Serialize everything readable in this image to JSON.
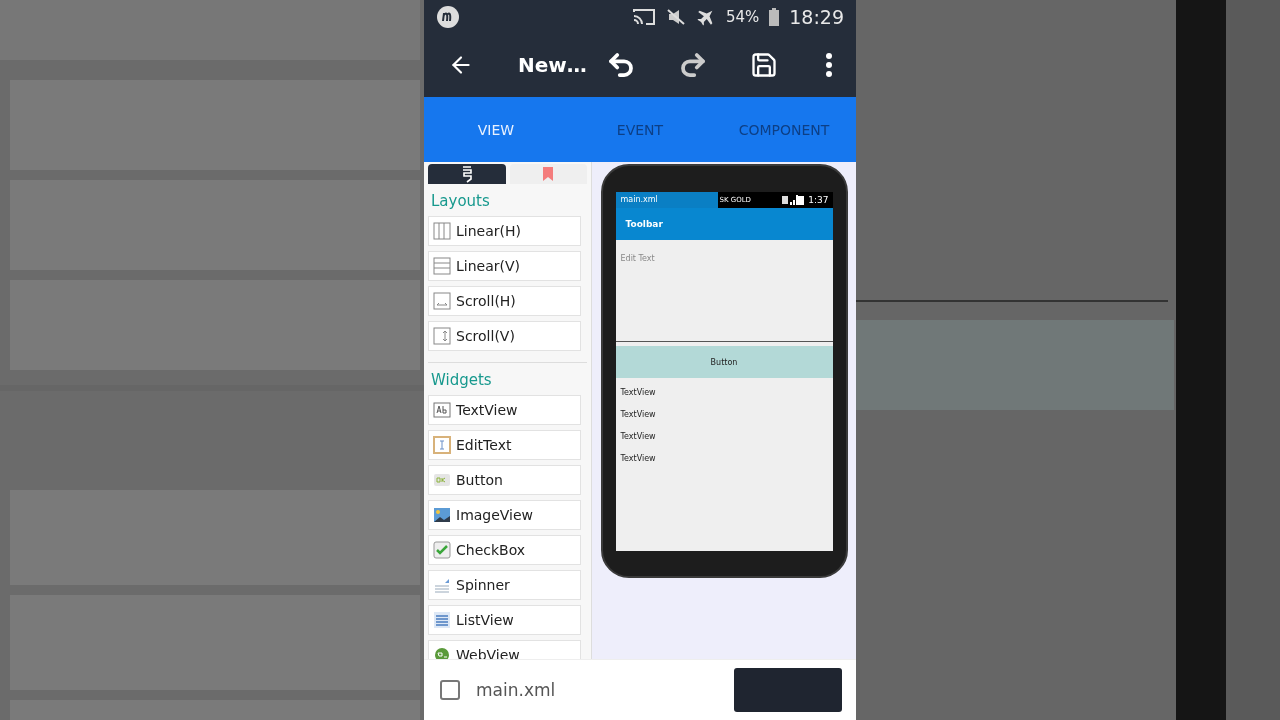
{
  "status_bar": {
    "battery": "54%",
    "time": "18:29"
  },
  "toolbar": {
    "title": "New…"
  },
  "tabs": [
    {
      "label": "VIEW",
      "selected": true
    },
    {
      "label": "EVENT",
      "selected": false
    },
    {
      "label": "COMPONENT",
      "selected": false
    }
  ],
  "palette": {
    "tabs": [
      {
        "kind": "widgets",
        "selected": true
      },
      {
        "kind": "bookmark",
        "selected": false
      }
    ],
    "sections": [
      {
        "title": "Layouts",
        "items": [
          {
            "label": "Linear(H)",
            "kind": "linear-h"
          },
          {
            "label": "Linear(V)",
            "kind": "linear-v"
          },
          {
            "label": "Scroll(H)",
            "kind": "scroll-h"
          },
          {
            "label": "Scroll(V)",
            "kind": "scroll-v"
          }
        ]
      },
      {
        "title": "Widgets",
        "items": [
          {
            "label": "TextView",
            "kind": "textview"
          },
          {
            "label": "EditText",
            "kind": "edittext"
          },
          {
            "label": "Button",
            "kind": "button"
          },
          {
            "label": "ImageView",
            "kind": "imageview"
          },
          {
            "label": "CheckBox",
            "kind": "checkbox"
          },
          {
            "label": "Spinner",
            "kind": "spinner"
          },
          {
            "label": "ListView",
            "kind": "listview"
          },
          {
            "label": "WebView",
            "kind": "webview"
          }
        ]
      }
    ]
  },
  "preview": {
    "file": "main.xml",
    "carrier": "SK GOLD",
    "time": "1:37",
    "toolbar_title": "Toolbar",
    "widgets": [
      {
        "kind": "edittext",
        "hint": "Edit Text"
      },
      {
        "kind": "button",
        "label": "Button"
      },
      {
        "kind": "textview",
        "text": "TextView"
      },
      {
        "kind": "textview",
        "text": "TextView"
      },
      {
        "kind": "textview",
        "text": "TextView"
      },
      {
        "kind": "textview",
        "text": "TextView"
      }
    ]
  },
  "bottom_bar": {
    "file": "main.xml"
  }
}
